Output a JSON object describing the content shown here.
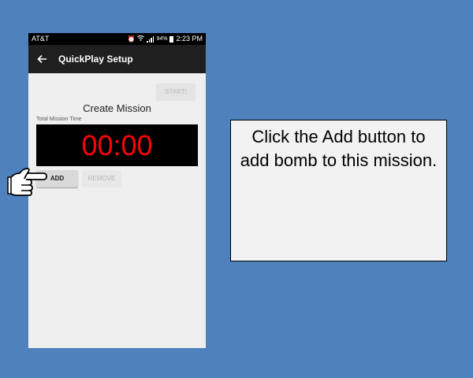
{
  "status_bar": {
    "carrier": "AT&T",
    "battery": "94%",
    "time": "2:23 PM"
  },
  "app_bar": {
    "title": "QuickPlay Setup",
    "back_icon": "back-arrow-icon"
  },
  "setup": {
    "start_label": "START!",
    "title": "Create Mission",
    "time_label": "Total Mission Time",
    "timer_value": "00:00",
    "add_label": "ADD",
    "remove_label": "REMOVE"
  },
  "pointer_icon": "pointing-hand-icon",
  "callout": {
    "text": "Click the Add button to add bomb to this mission."
  },
  "colors": {
    "background": "#4f81bd",
    "timer_text": "#ff0000",
    "timer_bg": "#000000",
    "app_bar": "#1f1f1f"
  }
}
